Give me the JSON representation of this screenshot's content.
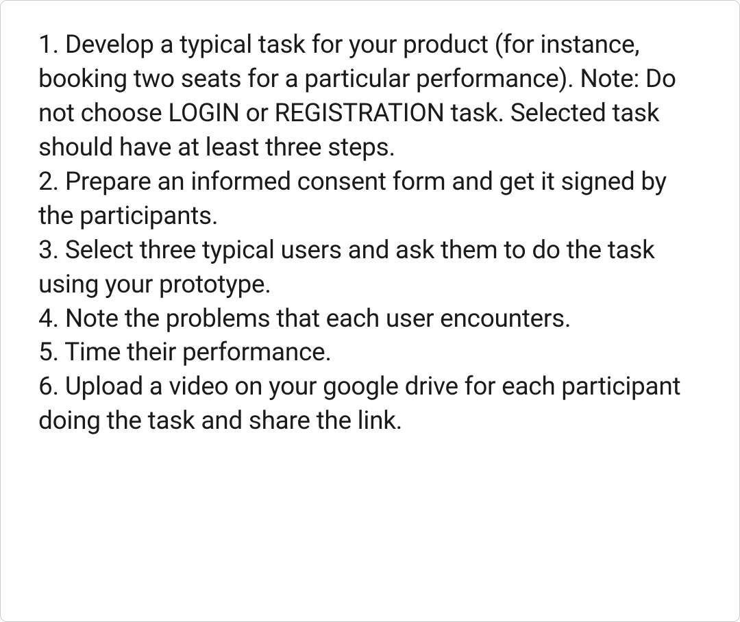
{
  "instructions": {
    "item1": "1. Develop a typical task for your product (for instance, booking two seats for a particular performance). Note: Do not choose LOGIN or REGISTRATION task. Selected task should have at least three steps.",
    "item2": "2. Prepare an informed consent form and get it signed by the participants.",
    "item3": "3. Select three typical users and ask them to do the task using your prototype.",
    "item4": "4. Note the problems that each user encounters.",
    "item5": "5. Time their performance.",
    "item6": "6. Upload a video on your google drive for each participant doing the task and share the link."
  }
}
